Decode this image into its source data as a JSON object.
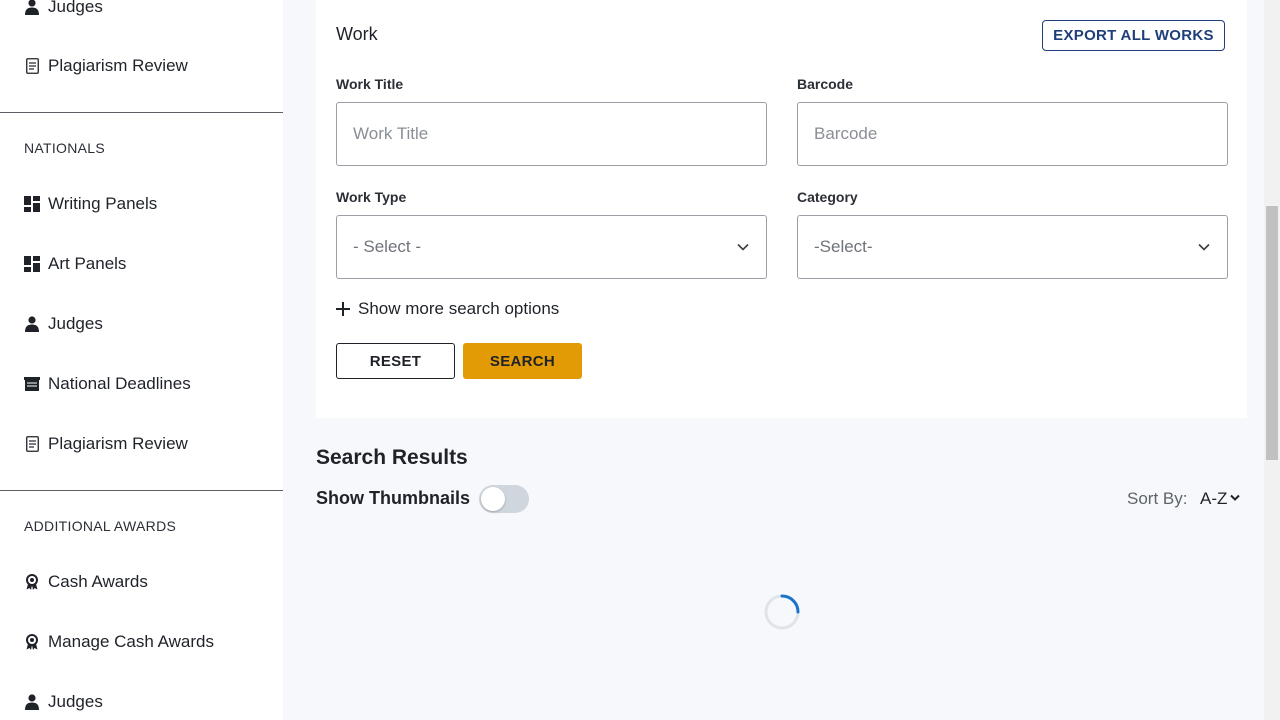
{
  "sidebar": {
    "top_items": [
      {
        "label": "Judges",
        "icon": "person-icon"
      },
      {
        "label": "Plagiarism Review",
        "icon": "document-icon"
      }
    ],
    "nationals": {
      "heading": "NATIONALS",
      "items": [
        {
          "label": "Writing Panels",
          "icon": "grid-icon"
        },
        {
          "label": "Art Panels",
          "icon": "grid-icon"
        },
        {
          "label": "Judges",
          "icon": "person-icon"
        },
        {
          "label": "National Deadlines",
          "icon": "calendar-icon"
        },
        {
          "label": "Plagiarism Review",
          "icon": "document-icon"
        }
      ]
    },
    "additional_awards": {
      "heading": "ADDITIONAL AWARDS",
      "items": [
        {
          "label": "Cash Awards",
          "icon": "award-icon"
        },
        {
          "label": "Manage Cash Awards",
          "icon": "award-icon"
        },
        {
          "label": "Judges",
          "icon": "person-icon"
        }
      ]
    }
  },
  "work": {
    "title": "Work",
    "export_label": "EXPORT ALL WORKS",
    "fields": {
      "work_title": {
        "label": "Work Title",
        "placeholder": "Work Title",
        "value": ""
      },
      "barcode": {
        "label": "Barcode",
        "placeholder": "Barcode",
        "value": ""
      },
      "work_type": {
        "label": "Work Type",
        "selected": "- Select -"
      },
      "category": {
        "label": "Category",
        "selected": "-Select-"
      }
    },
    "more_options_label": "Show more search options",
    "reset_label": "RESET",
    "search_label": "SEARCH"
  },
  "results": {
    "title": "Search Results",
    "thumbnails_label": "Show Thumbnails",
    "thumbnails_on": false,
    "sort_label": "Sort By:",
    "sort_value": "A-Z"
  },
  "colors": {
    "accent": "#e39b05",
    "export_border": "#1f3f7a",
    "spinner": "#1a73c8",
    "background": "#f6f8fb"
  }
}
